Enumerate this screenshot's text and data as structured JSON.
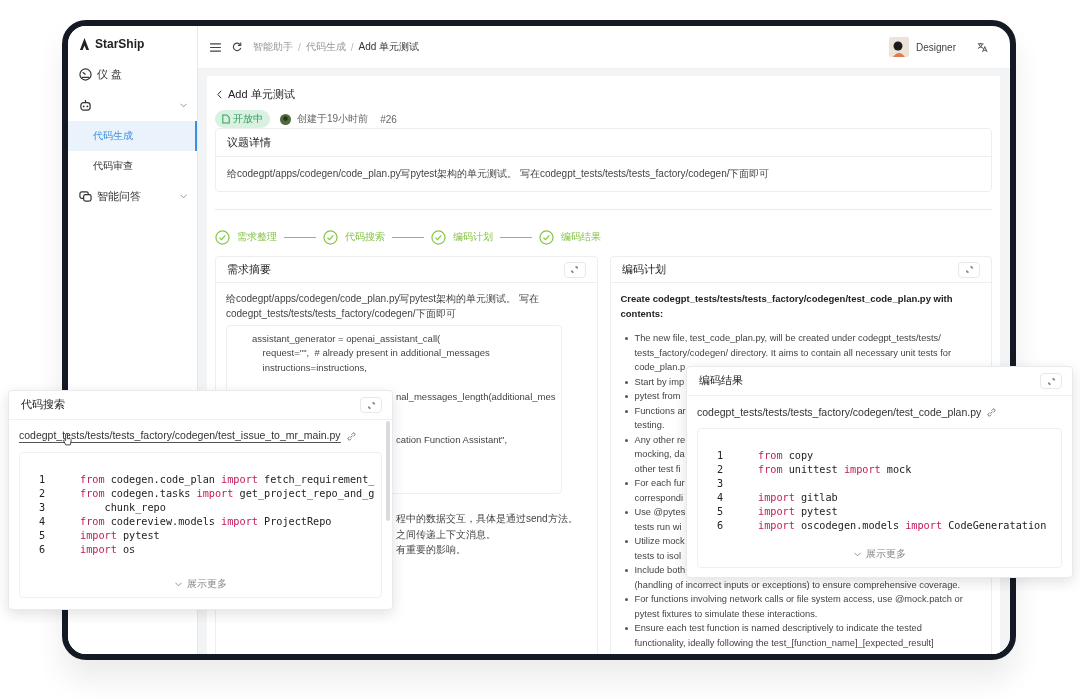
{
  "app": {
    "logo": "StarShip"
  },
  "sidebar": {
    "items": [
      {
        "kind": "link",
        "label": "仪 盘",
        "selected": false
      },
      {
        "kind": "group",
        "selected": false,
        "children": [
          {
            "label": "代码生成",
            "selected": true
          },
          {
            "label": "代码审查",
            "selected": false
          }
        ]
      },
      {
        "kind": "group",
        "label": "智能问答",
        "selected": false
      }
    ]
  },
  "topbar": {
    "breadcrumbs": [
      "智能助手",
      "代码生成",
      "Add 单元测试"
    ],
    "separator": "/",
    "user": "Designer"
  },
  "issue": {
    "title": "Add 单元测试",
    "status": "开放中",
    "created": "创建于19小时前",
    "number": "#26"
  },
  "details": {
    "title": "议题详情",
    "text": "给codegpt/apps/codegen/code_plan.py写pytest架构的单元测试。 写在codegpt_tests/tests/tests_factory/codegen/下面即可"
  },
  "steps": [
    {
      "label": "需求整理",
      "done": true
    },
    {
      "label": "代码搜索",
      "done": true
    },
    {
      "label": "编码计划",
      "done": true
    },
    {
      "label": "编码结果",
      "done": true
    }
  ],
  "summary": {
    "title": "需求摘要",
    "text": "给codegpt/apps/codegen/code_plan.py写pytest架构的单元测试。 写在codegpt_tests/tests/tests_factory/codegen/下面即可",
    "code": [
      {
        "kind": "line",
        "text": "assistant_generator = openai_assistant_call(",
        "covered": false
      },
      {
        "kind": "line",
        "text": "    request=\"\",  # already present in additional_messages",
        "covered": false
      },
      {
        "kind": "line",
        "text": "    instructions=instructions,",
        "covered": false
      },
      {
        "kind": "blank"
      },
      {
        "kind": "line",
        "text": "nal_messages_length(additional_mes",
        "covered": true
      },
      {
        "kind": "blank"
      },
      {
        "kind": "blank"
      },
      {
        "kind": "line",
        "text": "cation Function Assistant\",",
        "covered": true
      }
    ],
    "notes": [
      {
        "text": "程中的数据交互，具体是通过send方法。",
        "covered": true
      },
      {
        "text": "之间传递上下文消息。",
        "covered": true
      },
      {
        "text": "有重要的影响。",
        "covered": true
      }
    ]
  },
  "plan": {
    "title": "编码计划",
    "heading": "Create codegpt_tests/tests/tests_factory/codegen/test_code_plan.py with contents:",
    "bullets": [
      {
        "lines": [
          "The new file, test_code_plan.py, will be created under codegpt_tests/tests/",
          "tests_factory/codegen/ directory. It aims to contain all necessary unit tests for",
          "code_plan.p"
        ]
      },
      {
        "lines": [
          "Start by imp"
        ]
      },
      {
        "lines": [
          "pytest from"
        ]
      },
      {
        "lines": [
          "Functions ar",
          "testing."
        ]
      },
      {
        "lines": [
          "Any other re",
          "mocking, da",
          "other test fi"
        ]
      },
      {
        "lines": [
          "For each fur",
          "correspondi"
        ]
      },
      {
        "lines": [
          "Use @pytes",
          "tests run wi"
        ]
      },
      {
        "lines": [
          "Utilize mock",
          "tests to isol"
        ]
      },
      {
        "lines": [
          "Include both",
          "(handling of incorrect inputs or exceptions) to ensure comprehensive coverage."
        ]
      },
      {
        "lines": [
          "For functions involving network calls or file system access, use @mock.patch or",
          "pytest fixtures to simulate these interactions."
        ]
      },
      {
        "lines": [
          "Ensure each test function is named descriptively to indicate the tested",
          "functionality, ideally following the test_[function_name]_[expected_result]"
        ]
      }
    ]
  },
  "search_popup": {
    "title": "代码搜索",
    "file": "codegpt_tests/tests/tests_factory/codegen/test_issue_to_mr_main.py",
    "show_more": "展示更多",
    "lines": [
      {
        "n": "1",
        "tokens": [
          {
            "t": "from",
            "kw": true
          },
          {
            "t": " codegen.code_plan ",
            "kw": false
          },
          {
            "t": "import",
            "kw": true
          },
          {
            "t": " fetch_requirement_",
            "kw": false
          }
        ]
      },
      {
        "n": "2",
        "tokens": [
          {
            "t": "from",
            "kw": true
          },
          {
            "t": " codegen.tasks ",
            "kw": false
          },
          {
            "t": "import",
            "kw": true
          },
          {
            "t": " get_project_repo_and_g",
            "kw": false
          }
        ]
      },
      {
        "n": "3",
        "tokens": [
          {
            "t": "    chunk_repo",
            "kw": false
          }
        ]
      },
      {
        "n": "4",
        "tokens": [
          {
            "t": "from",
            "kw": true
          },
          {
            "t": " codereview.models ",
            "kw": false
          },
          {
            "t": "import",
            "kw": true
          },
          {
            "t": " ProjectRepo",
            "kw": false
          }
        ]
      },
      {
        "n": "5",
        "tokens": [
          {
            "t": "import",
            "kw": true
          },
          {
            "t": " pytest",
            "kw": false
          }
        ]
      },
      {
        "n": "6",
        "tokens": [
          {
            "t": "import",
            "kw": true
          },
          {
            "t": " os",
            "kw": false
          }
        ]
      }
    ]
  },
  "result_popup": {
    "title": "编码结果",
    "file": "codegpt_tests/tests/tests_factory/codegen/test_code_plan.py",
    "show_more": "展示更多",
    "lines": [
      {
        "n": "1",
        "tokens": [
          {
            "t": "from",
            "kw": true
          },
          {
            "t": " copy",
            "kw": false
          }
        ]
      },
      {
        "n": "2",
        "tokens": [
          {
            "t": "from",
            "kw": true
          },
          {
            "t": " unittest ",
            "kw": false
          },
          {
            "t": "import",
            "kw": true
          },
          {
            "t": " mock",
            "kw": false
          }
        ]
      },
      {
        "n": "3"
      },
      {
        "n": "4",
        "tokens": [
          {
            "t": "import",
            "kw": true
          },
          {
            "t": " gitlab",
            "kw": false
          }
        ]
      },
      {
        "n": "5",
        "tokens": [
          {
            "t": "import",
            "kw": true
          },
          {
            "t": " pytest",
            "kw": false
          }
        ]
      },
      {
        "n": "6",
        "tokens": [
          {
            "t": "import",
            "kw": true
          },
          {
            "t": " oscodegen.models ",
            "kw": false
          },
          {
            "t": "import",
            "kw": true
          },
          {
            "t": " CodeGeneratation",
            "kw": false
          }
        ]
      }
    ]
  }
}
